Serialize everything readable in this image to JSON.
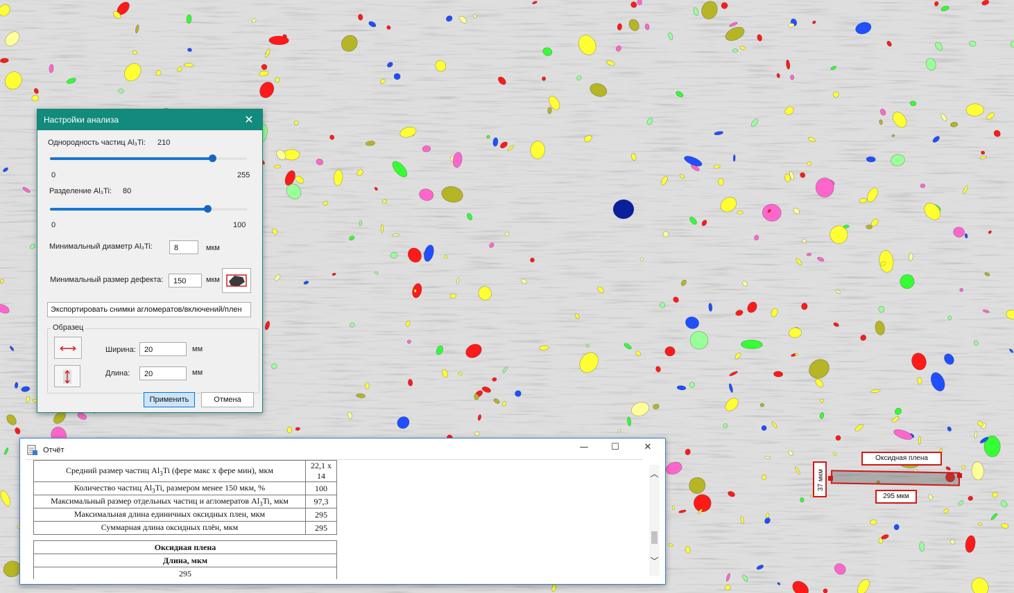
{
  "settings": {
    "title": "Настройки анализа",
    "close_glyph": "✕",
    "uniformity_label": "Однородность частиц Al₃Ti:",
    "uniformity_value": "210",
    "uniformity_min": "0",
    "uniformity_max": "255",
    "uniformity_fraction": 0.8235,
    "separation_label": "Разделение Al₃Ti:",
    "separation_value": "80",
    "separation_min": "0",
    "separation_max": "100",
    "separation_fraction": 0.8,
    "min_diameter_label": "Минимальный диаметр Al₃Ti:",
    "min_diameter_value": "8",
    "min_diameter_unit": "мкм",
    "min_defect_label": "Минимальный размер дефекта:",
    "min_defect_value": "150",
    "min_defect_unit": "мкм",
    "export_label": "Экспортировать снимки агломератов/включений/плен",
    "sample_group": "Образец",
    "width_label": "Ширина:",
    "width_value": "20",
    "width_unit": "мм",
    "length_label": "Длина:",
    "length_value": "20",
    "length_unit": "мм",
    "apply_label": "Применить",
    "cancel_label": "Отмена"
  },
  "report": {
    "title": "Отчёт",
    "minimize_glyph": "—",
    "maximize_glyph": "☐",
    "close_glyph": "✕",
    "rows": [
      {
        "label_pre": "Средний размер частиц Al",
        "sub": "3",
        "label_post": "Ti (фере макс х фере мин), мкм",
        "value": "22,1 х 14"
      },
      {
        "label_pre": "Количество частиц Al",
        "sub": "3",
        "label_post": "Ti, размером менее 150 мкм, %",
        "value": "100"
      },
      {
        "label_pre": "Максимальный размер отдельных частиц и агломератов Al",
        "sub": "3",
        "label_post": "Ti, мкм",
        "value": "97,3"
      },
      {
        "label_pre": "Максимальная длина единичных оксидных плен, мкм",
        "sub": "",
        "label_post": "",
        "value": "295"
      },
      {
        "label_pre": "Суммарная длина оксидных плён, мкм",
        "sub": "",
        "label_post": "",
        "value": "295"
      }
    ],
    "film_title": "Оксидная плена",
    "film_header": "Длина, мкм",
    "film_value": "295",
    "scroll_up": "︿",
    "scroll_down": "﹀"
  },
  "annotation": {
    "label": "Оксидная плена",
    "length": "295 мкм",
    "height": "37 мкм"
  },
  "colors": {
    "accent": "#128a7c",
    "slider": "#1976d2",
    "annotation": "#d01818"
  }
}
